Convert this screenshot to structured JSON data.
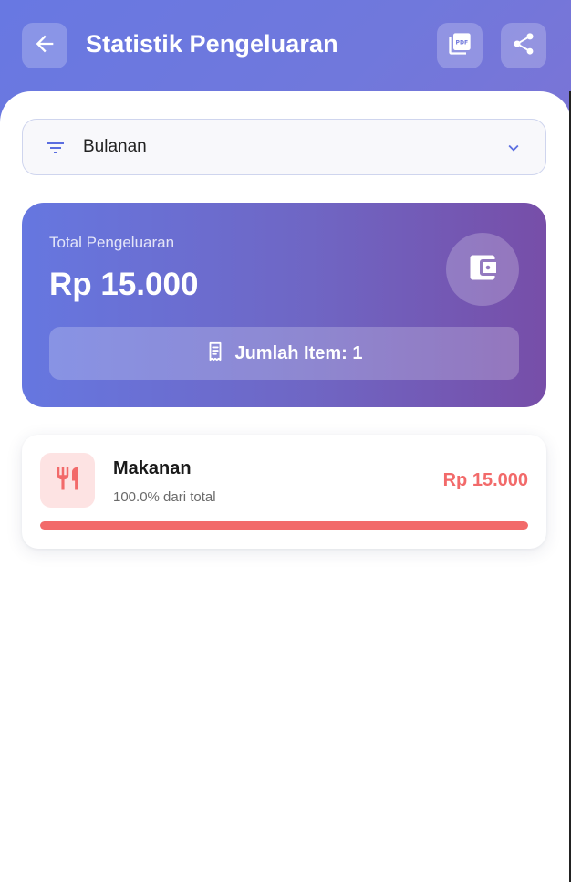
{
  "header": {
    "title": "Statistik Pengeluaran",
    "back_icon": "arrow-left-icon",
    "pdf_icon": "pdf-icon",
    "share_icon": "share-icon"
  },
  "filter": {
    "selected": "Bulanan",
    "icon": "filter-icon",
    "chevron_icon": "chevron-down-icon"
  },
  "summary": {
    "label": "Total Pengeluaran",
    "amount": "Rp 15.000",
    "wallet_icon": "wallet-icon",
    "items_label": "Jumlah Item: 1",
    "items_icon": "receipt-icon"
  },
  "categories": [
    {
      "name": "Makanan",
      "percent_text": "100.0% dari total",
      "amount": "Rp 15.000",
      "progress": 1.0,
      "icon": "utensils-icon",
      "color": "#f26a6a"
    }
  ],
  "colors": {
    "header": "#6878e2",
    "accent": "#5b6ee0",
    "category": "#f26a6a"
  }
}
